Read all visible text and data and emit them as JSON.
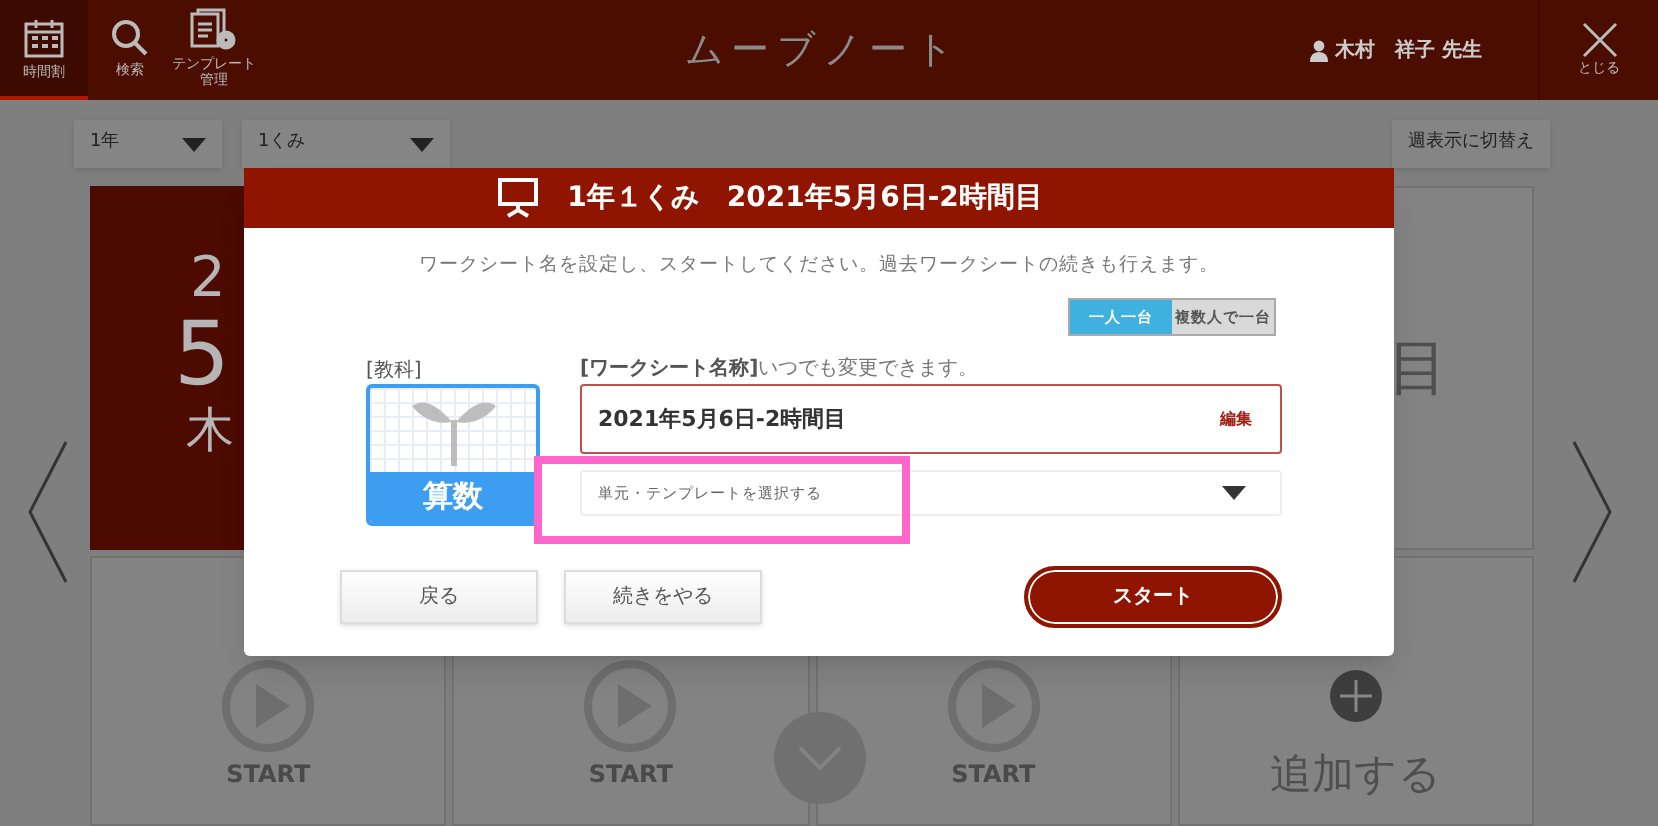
{
  "header": {
    "title": "ムーブノート",
    "nav": [
      {
        "kind": "calendar",
        "label": "時間割",
        "selected": true
      },
      {
        "kind": "search",
        "label": "検索",
        "selected": false
      },
      {
        "kind": "template",
        "label": "テンプレート",
        "label_line2": "管理",
        "selected": false
      }
    ],
    "user": "木村　祥子 先生",
    "close_label": "とじる"
  },
  "toolbar": {
    "grade": "1年",
    "class": "1くみ",
    "week_button": "週表示に切替え"
  },
  "day_card": {
    "year": "2",
    "month": "5",
    "weekday": "木"
  },
  "side_card_text": "目",
  "period_cards": [
    {
      "kind": "start",
      "start_label": "START"
    },
    {
      "kind": "start",
      "start_label": "START"
    },
    {
      "kind": "start",
      "start_label": "START"
    },
    {
      "kind": "add",
      "label": "追加する"
    }
  ],
  "modal": {
    "title": "1年１くみ　2021年5月6日-2時間目",
    "instruction": "ワークシート名を設定し、スタートしてください。過去ワークシートの続きも行えます。",
    "modes": [
      {
        "label": "一人一台",
        "selected": true
      },
      {
        "label": "複数人で一台",
        "selected": false
      }
    ],
    "subject_label": "[教科]",
    "subject": "算数",
    "name_label": "[ワークシート名称]",
    "name_hint": "いつでも変更できます。",
    "name_value": "2021年5月6日-2時間目",
    "edit_label": "編集",
    "template_placeholder": "単元・テンプレートを選択する",
    "buttons": [
      {
        "kind": "back",
        "label": "戻る"
      },
      {
        "kind": "continue",
        "label": "続きをやる"
      },
      {
        "kind": "start",
        "label": "スタート"
      }
    ]
  }
}
